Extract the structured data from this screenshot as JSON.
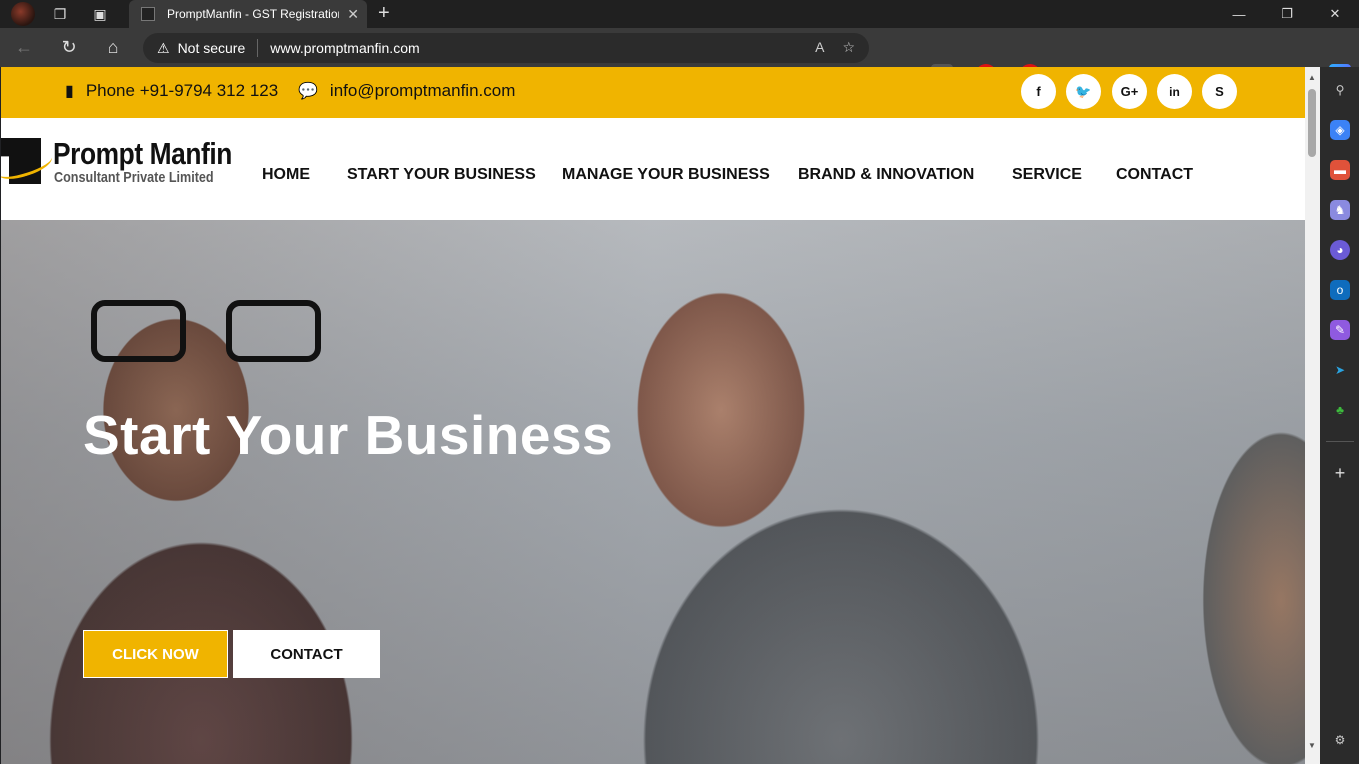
{
  "browser": {
    "tab_title": "PromptManfin - GST Registration",
    "security_label": "Not secure",
    "url": "www.promptmanfin.com"
  },
  "site": {
    "phone": "Phone +91-9794 312 123",
    "email": "info@promptmanfin.com",
    "social": [
      "facebook-icon",
      "twitter-icon",
      "google-plus-icon",
      "linkedin-icon",
      "skype-icon"
    ],
    "logo_name": "Prompt Manfin",
    "logo_sub": "Consultant Private Limited",
    "menu": [
      "HOME",
      "START YOUR BUSINESS",
      "MANAGE YOUR BUSINESS",
      "BRAND & INNOVATION",
      "SERVICE",
      "CONTACT"
    ],
    "hero_title": "Start Your Business",
    "cta_primary": "CLICK NOW",
    "cta_secondary": "CONTACT",
    "accent_color": "#f0b400"
  }
}
